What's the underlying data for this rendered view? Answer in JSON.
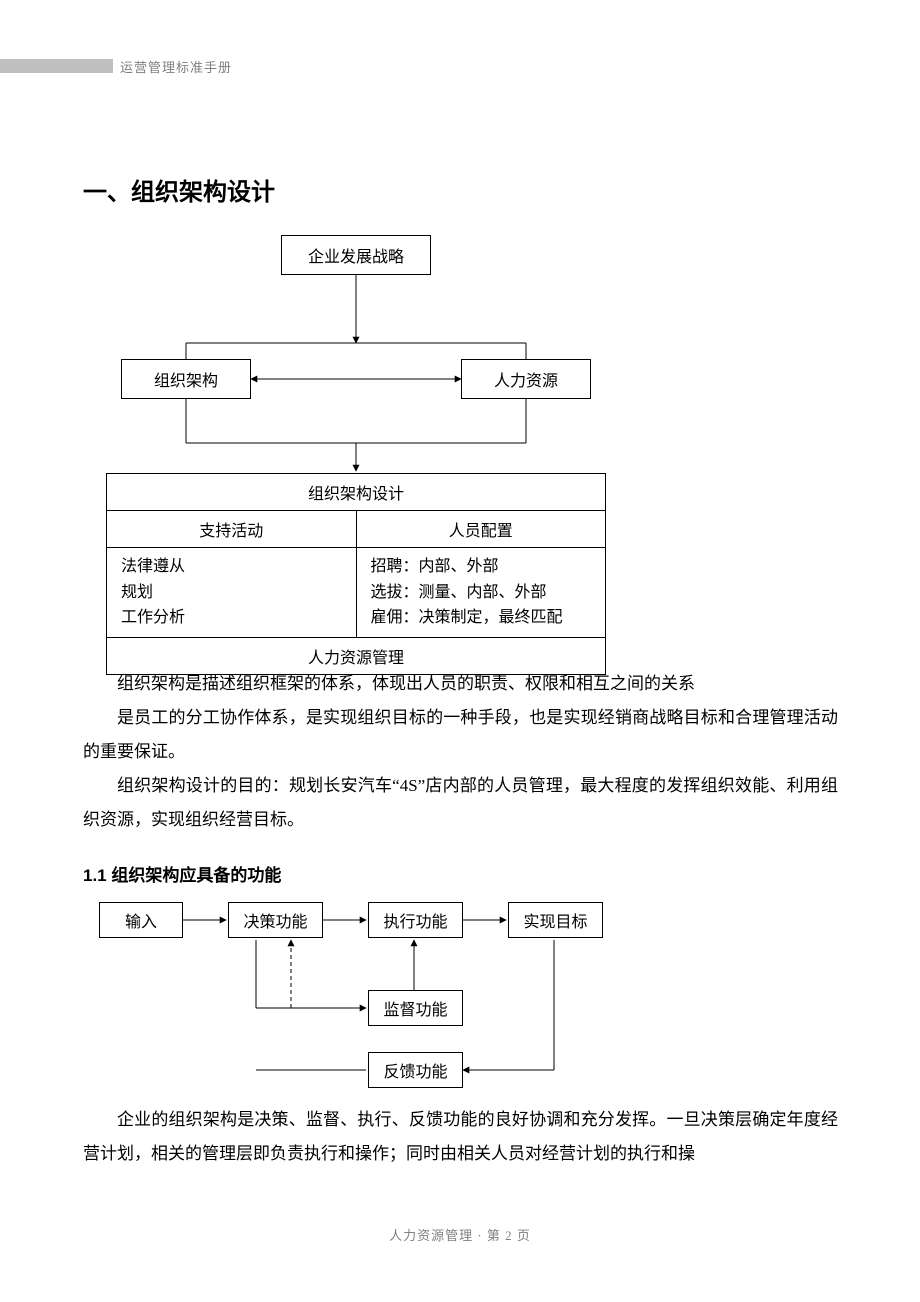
{
  "header": "运营管理标准手册",
  "h1": "一、组织架构设计",
  "diagram1": {
    "top": "企业发展战略",
    "left": "组织架构",
    "right": "人力资源",
    "table_title": "组织架构设计",
    "col1_head": "支持活动",
    "col2_head": "人员配置",
    "col1_body": "法律遵从\n规划\n工作分析",
    "col2_body": "招聘：内部、外部\n选拔：测量、内部、外部\n雇佣：决策制定，最终匹配",
    "table_footer": "人力资源管理"
  },
  "p1": "组织架构是描述组织框架的体系，体现出人员的职责、权限和相互之间的关系",
  "p2": "是员工的分工协作体系，是实现组织目标的一种手段，也是实现经销商战略目标和合理管理活动的重要保证。",
  "p3": "组织架构设计的目的：规划长安汽车“4S”店内部的人员管理，最大程度的发挥组织效能、利用组织资源，实现组织经营目标。",
  "h2": "1.1 组织架构应具备的功能",
  "diagram2": {
    "b1": "输入",
    "b2": "决策功能",
    "b3": "执行功能",
    "b4": "实现目标",
    "b5": "监督功能",
    "b6": "反馈功能"
  },
  "p4": "企业的组织架构是决策、监督、执行、反馈功能的良好协调和充分发挥。一旦决策层确定年度经营计划，相关的管理层即负责执行和操作；同时由相关人员对经营计划的执行和操",
  "footer": "人力资源管理 ·  第  2  页"
}
